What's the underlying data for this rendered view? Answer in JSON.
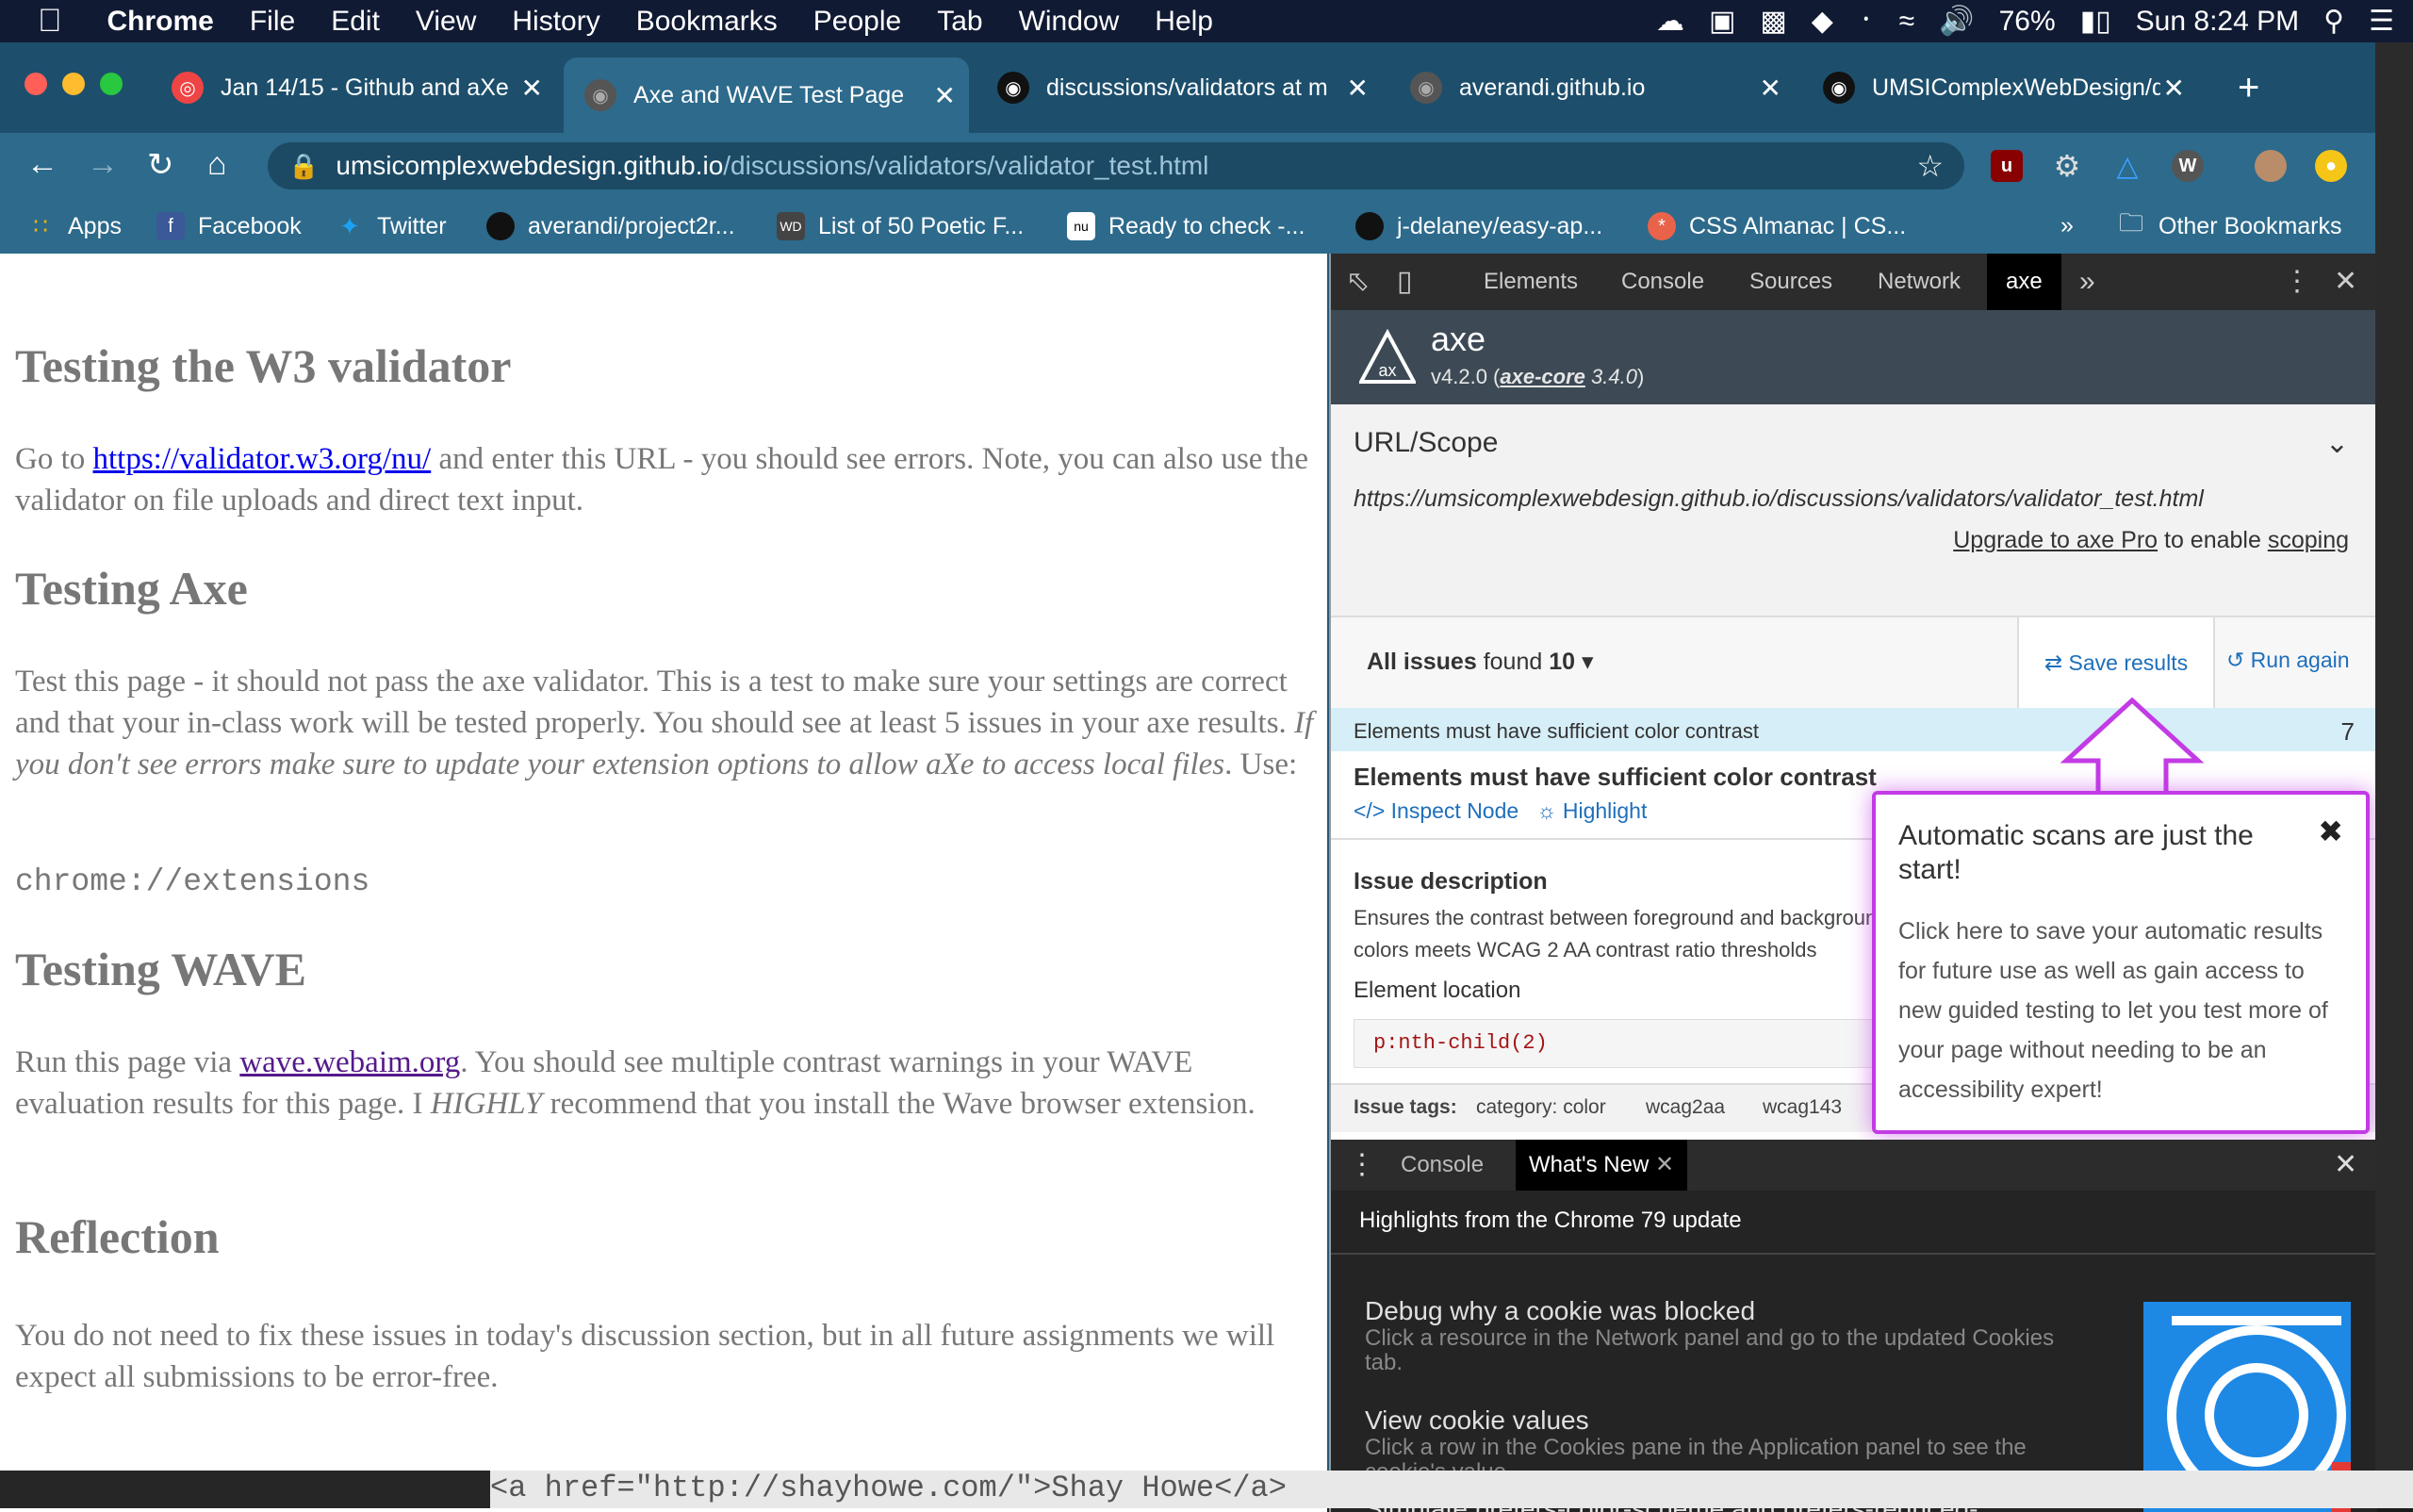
{
  "menubar": {
    "app": "Chrome",
    "items": [
      "File",
      "Edit",
      "View",
      "History",
      "Bookmarks",
      "People",
      "Tab",
      "Window",
      "Help"
    ],
    "battery": "76%",
    "clock": "Sun 8:24 PM"
  },
  "tabs": [
    {
      "title": "Jan 14/15 - Github and aXe",
      "favicon": "target-icon",
      "active": false
    },
    {
      "title": "Axe and WAVE Test Page",
      "favicon": "globe-icon",
      "active": true
    },
    {
      "title": "discussions/validators at m",
      "favicon": "github-icon",
      "active": false
    },
    {
      "title": "averandi.github.io",
      "favicon": "globe-icon",
      "active": false
    },
    {
      "title": "UMSIComplexWebDesign/d",
      "favicon": "github-icon",
      "active": false
    }
  ],
  "omnibox": {
    "host": "umsicomplexwebdesign.github.io",
    "path": "/discussions/validators/validator_test.html"
  },
  "bookmarks": [
    {
      "label": "Apps",
      "icon": "apps-grid-icon"
    },
    {
      "label": "Facebook",
      "icon": "facebook-icon"
    },
    {
      "label": "Twitter",
      "icon": "twitter-icon"
    },
    {
      "label": "averandi/project2r...",
      "icon": "github-icon"
    },
    {
      "label": "List of 50 Poetic F...",
      "icon": "wd-icon"
    },
    {
      "label": "Ready to check -...",
      "icon": "nu-icon"
    },
    {
      "label": "j-delaney/easy-ap...",
      "icon": "github-icon"
    },
    {
      "label": "CSS Almanac | CS...",
      "icon": "css-tricks-icon"
    }
  ],
  "other_bookmarks": "Other Bookmarks",
  "page": {
    "h_w3": "Testing the W3 validator",
    "p_w3_pre": "Go to ",
    "p_w3_link": "https://validator.w3.org/nu/",
    "p_w3_post": " and enter this URL - you should see errors. Note, you can also use the validator on file uploads and direct text input.",
    "h_axe": "Testing Axe",
    "p_axe_a": "Test this page - it should not pass the axe validator. This is a test to make sure your settings are correct and that your in-class work will be tested properly. You should see at least 5 issues in your axe results. ",
    "p_axe_em": "If you don't see errors make sure to update your extension options to allow aXe to access local files",
    "p_axe_b": ". Use:",
    "code_ext": "chrome://extensions",
    "h_wave": "Testing WAVE",
    "p_wave_pre": "Run this page via ",
    "p_wave_link": "wave.webaim.org",
    "p_wave_mid": ". You should see multiple contrast warnings in your WAVE evaluation results for this page. I ",
    "p_wave_em": "HIGHLY",
    "p_wave_post": " recommend that you install the Wave browser extension.",
    "h_refl": "Reflection",
    "p_refl": "You do not need to fix these issues in today's discussion section, but in all future assignments we will expect all submissions to be error-free."
  },
  "devtools": {
    "tabs": [
      "Elements",
      "Console",
      "Sources",
      "Network",
      "axe"
    ],
    "axe_name": "axe",
    "axe_version": "v4.2.0",
    "axe_core": "axe-core",
    "axe_core_version": "3.4.0",
    "url_scope_label": "URL/Scope",
    "url": "https://umsicomplexwebdesign.github.io/discussions/validators/validator_test.html",
    "upgrade_link": "Upgrade to axe Pro",
    "upgrade_mid": "to enable",
    "upgrade_scoping": "scoping",
    "issues_label": "All issues",
    "issues_found": "found",
    "issues_count": "10",
    "save_results": "Save results",
    "run_again": "Run again",
    "issue_row_title": "Elements must have sufficient color contrast",
    "issue_row_count": "7",
    "issue_heading": "Elements must have sufficient color contrast",
    "inspect_node": "Inspect Node",
    "highlight": "Highlight",
    "issue_desc_label": "Issue description",
    "issue_desc": "Ensures the contrast between foreground and background colors meets WCAG 2 AA contrast ratio thresholds",
    "element_location_label": "Element location",
    "element_selector": "p:nth-child(2)",
    "issue_tags_label": "Issue tags:",
    "tags": [
      "category: color",
      "wcag2aa",
      "wcag143"
    ],
    "callout_title": "Automatic scans are just the start!",
    "callout_body": "Click here to save your automatic results for future use as well as gain access to new guided testing to let you test more of your page without needing to be an accessibility expert!",
    "drawer_tabs": [
      "Console",
      "What's New"
    ],
    "drawer_heading": "Highlights from the Chrome 79 update",
    "news": [
      {
        "title": "Debug why a cookie was blocked",
        "desc": "Click a resource in the Network panel and go to the updated Cookies tab."
      },
      {
        "title": "View cookie values",
        "desc": "Click a row in the Cookies pane in the Application panel to see the cookie's value."
      },
      {
        "title": "Simulate prefers-color-scheme and prefers-reduced-",
        "desc": ""
      }
    ]
  },
  "desktop_code": "<a href=\"http://shayhowe.com/\">Shay Howe</a>",
  "colors": {
    "accent_purple": "#c23be4",
    "link_blue": "#1e6fbb",
    "chrome_theme": "#2d6a8b"
  }
}
